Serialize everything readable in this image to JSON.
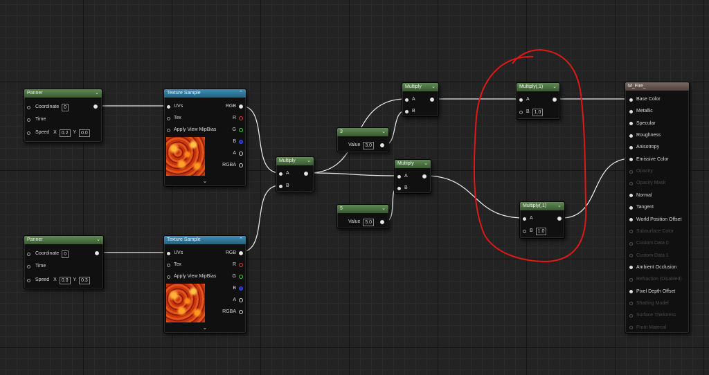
{
  "nodes": {
    "panner1": {
      "title": "Panner",
      "coordinate_label": "Coordinate",
      "coordinate_value": "0",
      "time_label": "Time",
      "speed_label": "Speed",
      "x_label": "X",
      "x_value": "0.2",
      "y_label": "Y",
      "y_value": "0.0"
    },
    "panner2": {
      "title": "Panner",
      "coordinate_label": "Coordinate",
      "coordinate_value": "0",
      "time_label": "Time",
      "speed_label": "Speed",
      "x_label": "X",
      "x_value": "0.0",
      "y_label": "Y",
      "y_value": "0.3"
    },
    "texture1": {
      "title": "Texture Sample",
      "uvs": "UVs",
      "tex": "Tex",
      "mipbias": "Apply View MipBias",
      "rgb": "RGB",
      "r": "R",
      "g": "G",
      "b": "B",
      "a": "A",
      "rgba": "RGBA"
    },
    "texture2": {
      "title": "Texture Sample",
      "uvs": "UVs",
      "tex": "Tex",
      "mipbias": "Apply View MipBias",
      "rgb": "RGB",
      "r": "R",
      "g": "G",
      "b": "B",
      "a": "A",
      "rgba": "RGBA"
    },
    "multiply_center": {
      "title": "Multiply",
      "a": "A",
      "b": "B"
    },
    "multiply_top": {
      "title": "Multiply",
      "a": "A",
      "b": "B"
    },
    "multiply_mid": {
      "title": "Multiply",
      "a": "A",
      "b": "B"
    },
    "const3": {
      "title": "3",
      "value_label": "Value",
      "value": "3.0"
    },
    "const5": {
      "title": "5",
      "value_label": "Value",
      "value": "5.0"
    },
    "multiply1_top": {
      "title": "Multiply(,1)",
      "a": "A",
      "b": "B",
      "b_value": "1.0"
    },
    "multiply1_bottom": {
      "title": "Multiply(,1)",
      "a": "A",
      "b": "B",
      "b_value": "1.0"
    },
    "material": {
      "title": "M_Fire_",
      "inputs": [
        {
          "label": "Base Color",
          "active": true
        },
        {
          "label": "Metallic",
          "active": true
        },
        {
          "label": "Specular",
          "active": true
        },
        {
          "label": "Roughness",
          "active": true
        },
        {
          "label": "Anisotropy",
          "active": true
        },
        {
          "label": "Emissive Color",
          "active": true
        },
        {
          "label": "Opacity",
          "active": false
        },
        {
          "label": "Opacity Mask",
          "active": false
        },
        {
          "label": "Normal",
          "active": true
        },
        {
          "label": "Tangent",
          "active": true
        },
        {
          "label": "World Position Offset",
          "active": true
        },
        {
          "label": "Subsurface Color",
          "active": false
        },
        {
          "label": "Custom Data 0",
          "active": false
        },
        {
          "label": "Custom Data 1",
          "active": false
        },
        {
          "label": "Ambient Occlusion",
          "active": true
        },
        {
          "label": "Refraction (Disabled)",
          "active": false
        },
        {
          "label": "Pixel Depth Offset",
          "active": true
        },
        {
          "label": "Shading Model",
          "active": false
        },
        {
          "label": "Surface Thickness",
          "active": false
        },
        {
          "label": "Front Material",
          "active": false
        }
      ]
    }
  },
  "colors": {
    "grid_bg": "#232323",
    "math_header": "#4e7444",
    "texture_header": "#2f7ba1",
    "result_header": "#655751",
    "annotation": "#e01818",
    "wire": "#e6e6e6"
  },
  "icons": {
    "collapse": "chevron-down-icon",
    "expand": "chevron-down-icon"
  }
}
